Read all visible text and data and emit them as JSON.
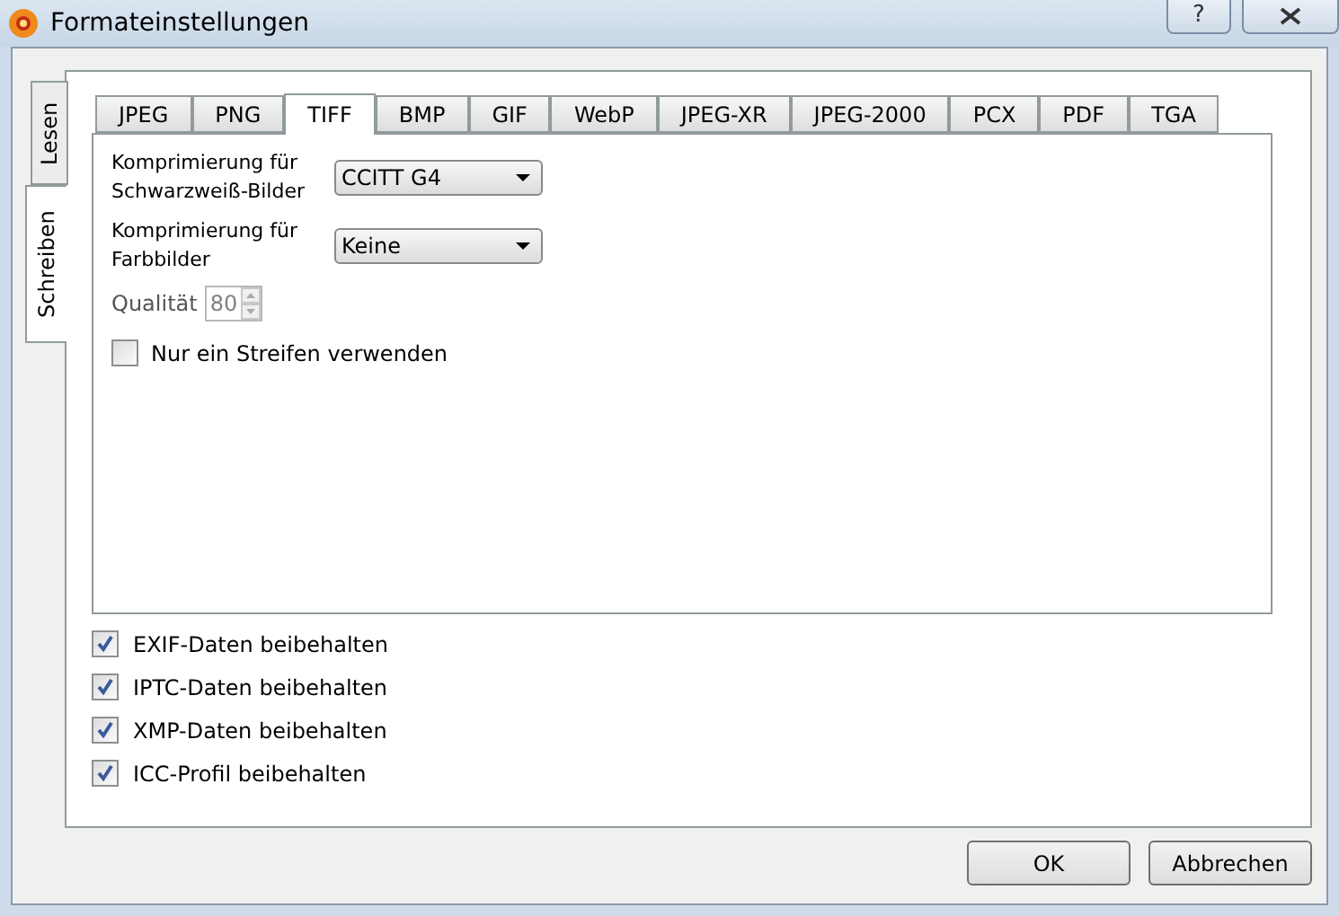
{
  "window": {
    "title": "Formateinstellungen",
    "help": "?"
  },
  "side_tabs": [
    {
      "label": "Lesen",
      "selected": false
    },
    {
      "label": "Schreiben",
      "selected": true
    }
  ],
  "format_tabs": [
    {
      "label": "JPEG",
      "selected": false
    },
    {
      "label": "PNG",
      "selected": false
    },
    {
      "label": "TIFF",
      "selected": true
    },
    {
      "label": "BMP",
      "selected": false
    },
    {
      "label": "GIF",
      "selected": false
    },
    {
      "label": "WebP",
      "selected": false
    },
    {
      "label": "JPEG-XR",
      "selected": false
    },
    {
      "label": "JPEG-2000",
      "selected": false
    },
    {
      "label": "PCX",
      "selected": false
    },
    {
      "label": "PDF",
      "selected": false
    },
    {
      "label": "TGA",
      "selected": false
    }
  ],
  "settings": [
    {
      "kind": "dropdown",
      "label": "Komprimierung für Schwarzweiß-Bilder",
      "value": "CCITT G4"
    },
    {
      "kind": "dropdown",
      "label": "Komprimierung für Farbbilder",
      "value": "Keine"
    },
    {
      "kind": "spinner",
      "label": "Qualität",
      "value": "80",
      "disabled": true
    },
    {
      "kind": "checkbox",
      "label": "Nur ein Streifen verwenden",
      "checked": false
    }
  ],
  "options": [
    {
      "label": "EXIF-Daten beibehalten",
      "checked": true
    },
    {
      "label": "IPTC-Daten beibehalten",
      "checked": true
    },
    {
      "label": "XMP-Daten beibehalten",
      "checked": true
    },
    {
      "label": "ICC-Profil beibehalten",
      "checked": true
    }
  ],
  "buttons": [
    "OK",
    "Abbrechen"
  ]
}
